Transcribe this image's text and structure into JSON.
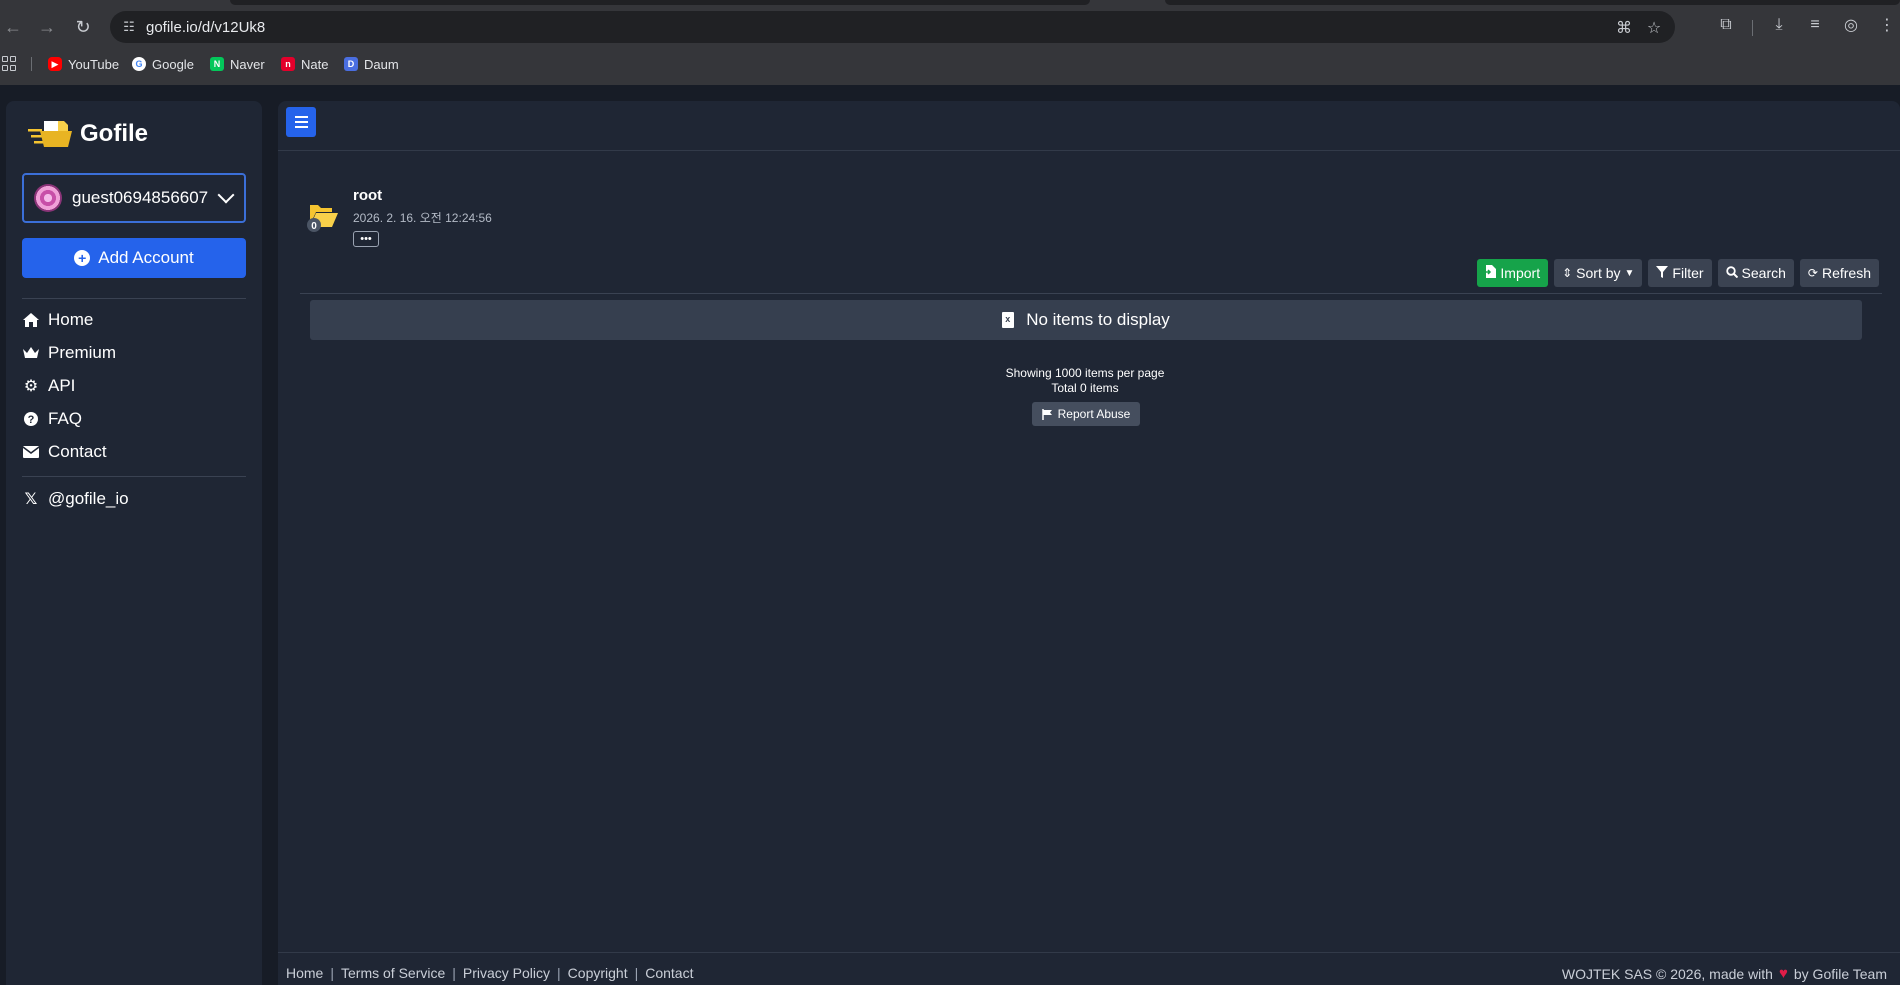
{
  "browser": {
    "url": "gofile.io/d/v12Uk8",
    "bookmarks": [
      {
        "label": "YouTube",
        "color": "#ff0000"
      },
      {
        "label": "Google",
        "color": "#4285f4"
      },
      {
        "label": "Naver",
        "color": "#03c75a"
      },
      {
        "label": "Nate",
        "color": "#e4002b"
      },
      {
        "label": "Daum",
        "color": "#4a6ee0"
      }
    ]
  },
  "sidebar": {
    "logo_text": "Gofile",
    "account_name": "guest0694856607",
    "add_account_label": "Add Account",
    "nav": [
      {
        "label": "Home",
        "icon": "home-icon"
      },
      {
        "label": "Premium",
        "icon": "crown-icon"
      },
      {
        "label": "API",
        "icon": "gears-icon"
      },
      {
        "label": "FAQ",
        "icon": "question-icon"
      },
      {
        "label": "Contact",
        "icon": "envelope-icon"
      }
    ],
    "social_label": "@gofile_io"
  },
  "main": {
    "folder_name": "root",
    "folder_badge": "0",
    "folder_date": "2026. 2. 16. 오전 12:24:56",
    "more_label": "•••",
    "actions": {
      "import": "Import",
      "sort": "Sort by",
      "filter": "Filter",
      "search": "Search",
      "refresh": "Refresh"
    },
    "empty_message": "No items to display",
    "paging_per_page": "Showing 1000 items per page",
    "paging_total": "Total 0 items",
    "report_label": "Report Abuse"
  },
  "footer": {
    "links": [
      "Home",
      "Terms of Service",
      "Privacy Policy",
      "Copyright",
      "Contact"
    ],
    "copyright_prefix": "WOJTEK SAS © 2026, made with",
    "copyright_suffix": "by Gofile Team"
  },
  "colors": {
    "primary": "#2563eb",
    "success": "#16a34a",
    "background": "#1f2634"
  }
}
